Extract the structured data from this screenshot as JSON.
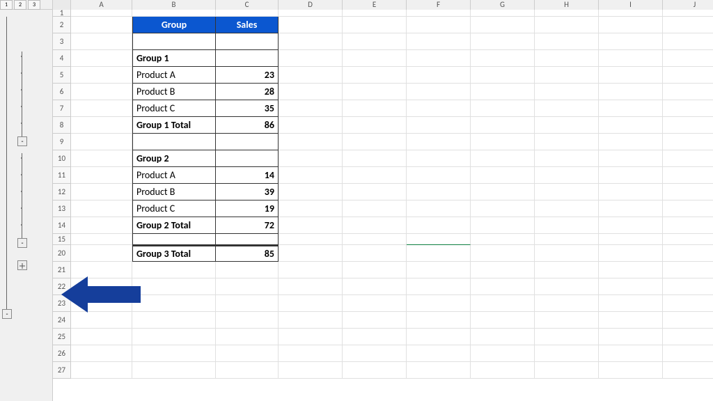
{
  "outline": {
    "levels": [
      "1",
      "2",
      "3"
    ],
    "collapse_label": "-",
    "expand_label": "+"
  },
  "columns": {
    "labels": [
      "A",
      "B",
      "C",
      "D",
      "E",
      "F",
      "G",
      "H",
      "I",
      "J"
    ],
    "widths": [
      88,
      120,
      90,
      92,
      92,
      92,
      92,
      92,
      92,
      92
    ]
  },
  "row_labels": [
    "1",
    "2",
    "3",
    "4",
    "5",
    "6",
    "7",
    "8",
    "9",
    "10",
    "11",
    "12",
    "13",
    "14",
    "15",
    "20",
    "21",
    "22",
    "23",
    "24",
    "25",
    "26",
    "27"
  ],
  "headers": {
    "group": "Group",
    "sales": "Sales"
  },
  "data": {
    "g1": {
      "title": "Group 1",
      "rows": [
        {
          "name": "Product A",
          "val": "23"
        },
        {
          "name": "Product B",
          "val": "28"
        },
        {
          "name": "Product C",
          "val": "35"
        }
      ],
      "total_label": "Group 1 Total",
      "total_val": "86"
    },
    "g2": {
      "title": "Group 2",
      "rows": [
        {
          "name": "Product A",
          "val": "14"
        },
        {
          "name": "Product B",
          "val": "39"
        },
        {
          "name": "Product C",
          "val": "19"
        }
      ],
      "total_label": "Group 2 Total",
      "total_val": "72"
    },
    "g3": {
      "total_label": "Group 3 Total",
      "total_val": "85"
    }
  },
  "selected_cell": "F15"
}
